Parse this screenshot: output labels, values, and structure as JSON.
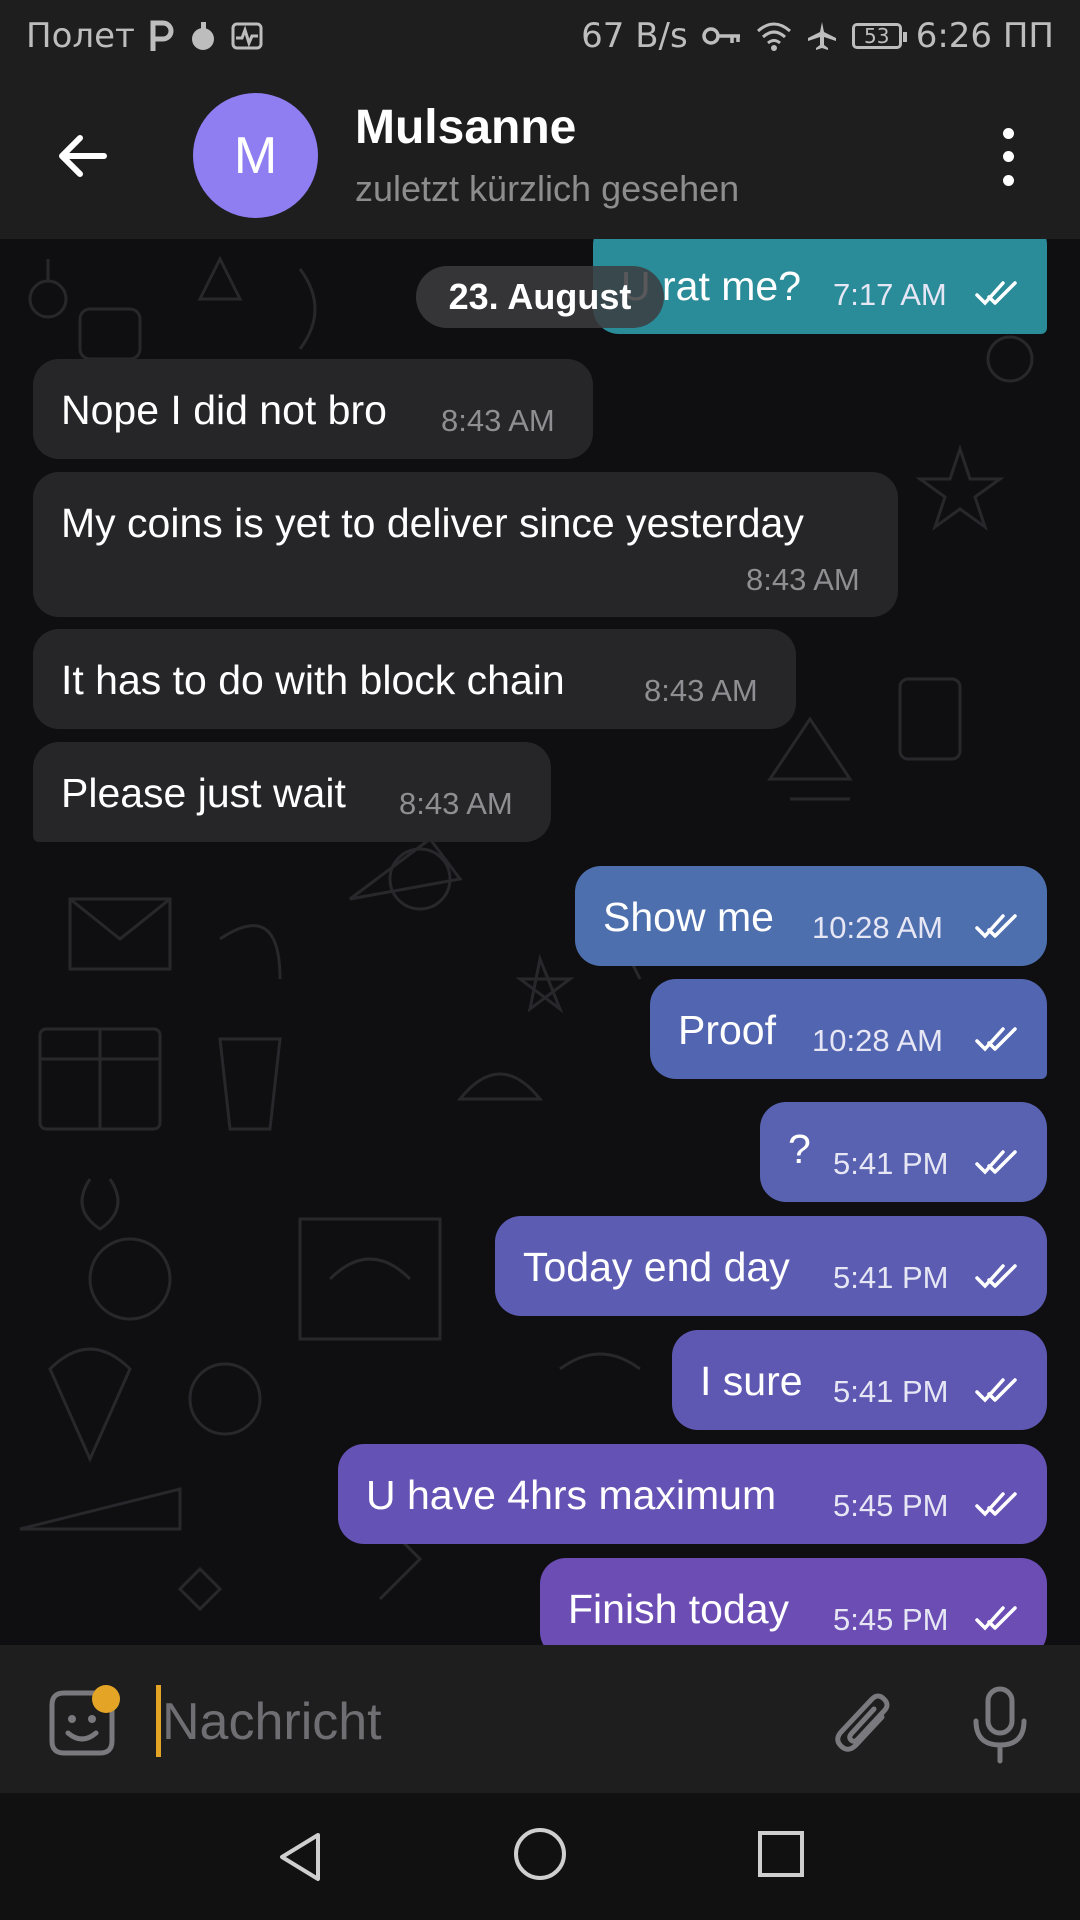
{
  "statusbar": {
    "carrier": "Полет",
    "speed": "67 B/s",
    "battery": "53",
    "time": "6:26 ПП"
  },
  "header": {
    "avatar_letter": "M",
    "name": "Mulsanne",
    "status": "zuletzt kürzlich gesehen"
  },
  "chat": {
    "date_label": "23. August",
    "messages": [
      {
        "dir": "out",
        "text": "U rat me?",
        "time": "7:17 AM",
        "color": "#2a8c99"
      },
      {
        "dir": "in",
        "text": "Nope I did not bro",
        "time": "8:43 AM"
      },
      {
        "dir": "in",
        "text": "My coins is yet to deliver since yesterday",
        "time": "8:43 AM"
      },
      {
        "dir": "in",
        "text": "It has to do with block chain",
        "time": "8:43 AM"
      },
      {
        "dir": "in",
        "text": "Please just wait",
        "time": "8:43 AM"
      },
      {
        "dir": "out",
        "text": "Show me",
        "time": "10:28 AM",
        "color": "#4e6fae"
      },
      {
        "dir": "out",
        "text": "Proof",
        "time": "10:28 AM",
        "color": "#5265b0"
      },
      {
        "dir": "out",
        "text": "?",
        "time": "5:41 PM",
        "color": "#5862b0"
      },
      {
        "dir": "out",
        "text": "Today end day",
        "time": "5:41 PM",
        "color": "#5c5db2"
      },
      {
        "dir": "out",
        "text": "I sure",
        "time": "5:41 PM",
        "color": "#5f58b3"
      },
      {
        "dir": "out",
        "text": "U have 4hrs maximum",
        "time": "5:45 PM",
        "color": "#6452b4"
      },
      {
        "dir": "out",
        "text": "Finish today",
        "time": "5:45 PM",
        "color": "#6b4db4"
      }
    ]
  },
  "input": {
    "placeholder": "Nachricht"
  },
  "colors": {
    "accent": "#e4a526",
    "avatar": "#8f7ef2",
    "incoming_bubble": "#262628"
  }
}
